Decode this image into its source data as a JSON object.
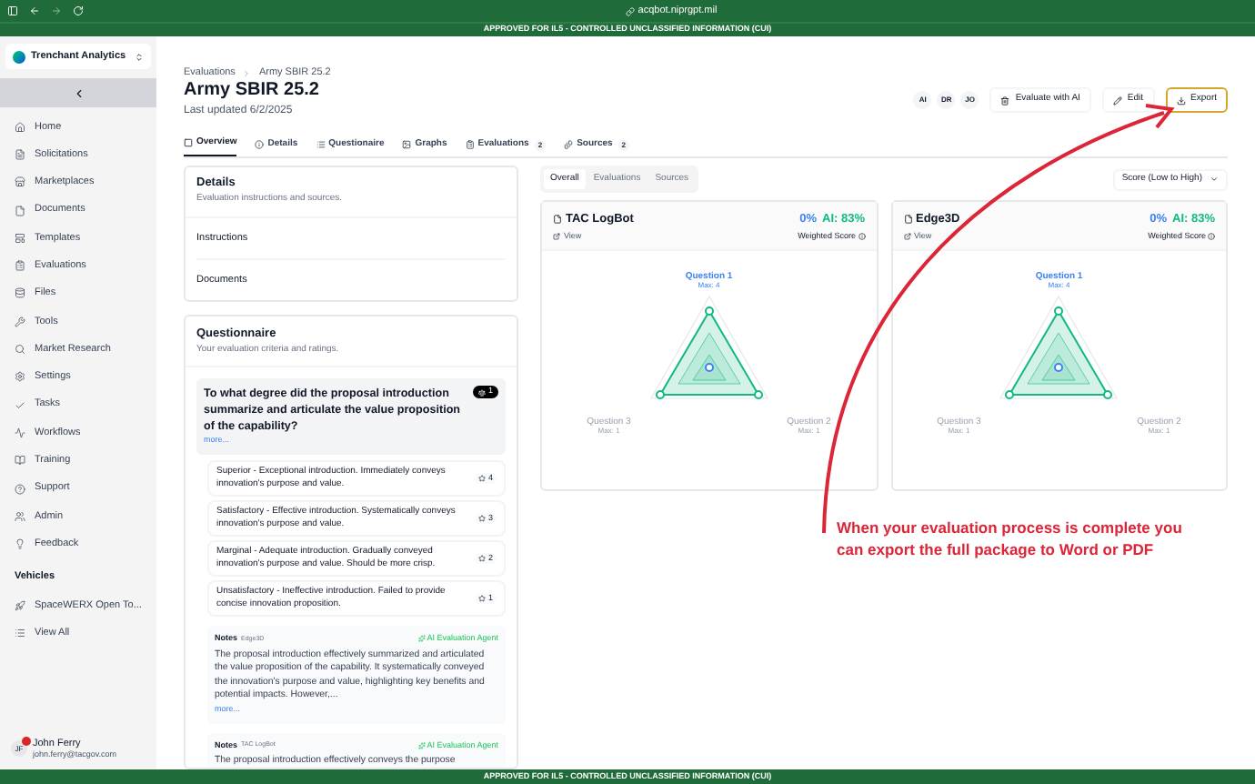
{
  "browser": {
    "url": "acqbot.niprgpt.mil"
  },
  "banner": {
    "top": "APPROVED FOR IL5 - CONTROLLED UNCLASSIFIED INFORMATION (CUI)",
    "bottom": "APPROVED FOR IL5 - CONTROLLED UNCLASSIFIED INFORMATION (CUI)"
  },
  "sidebar": {
    "org": "Trenchant Analytics",
    "items": [
      {
        "label": "Home"
      },
      {
        "label": "Solicitations"
      },
      {
        "label": "Marketplaces"
      },
      {
        "label": "Documents"
      },
      {
        "label": "Templates"
      },
      {
        "label": "Evaluations"
      },
      {
        "label": "Files"
      },
      {
        "label": "Tools"
      },
      {
        "label": "Market Research"
      },
      {
        "label": "Settings"
      },
      {
        "label": "Tasks"
      },
      {
        "label": "Workflows"
      },
      {
        "label": "Training"
      },
      {
        "label": "Support"
      },
      {
        "label": "Admin"
      },
      {
        "label": "Feedback"
      }
    ],
    "section": "Vehicles",
    "vehicles": [
      {
        "label": "SpaceWERX Open To..."
      },
      {
        "label": "View All"
      }
    ],
    "user": {
      "initials": "JF",
      "name": "John Ferry",
      "email": "john.ferry@tacgov.com"
    }
  },
  "header": {
    "breadcrumb": [
      "Evaluations",
      "Army SBIR 25.2"
    ],
    "title": "Army SBIR 25.2",
    "updated": "Last updated 6/2/2025",
    "avatars": [
      "AI",
      "DR",
      "JO"
    ],
    "buttons": [
      {
        "label": "Evaluate with AI",
        "highlighted": false
      },
      {
        "label": "Edit",
        "highlighted": false
      },
      {
        "label": "Export",
        "highlighted": true
      }
    ]
  },
  "tabs": [
    {
      "label": "Overview",
      "selected": true
    },
    {
      "label": "Details",
      "selected": false
    },
    {
      "label": "Questionaire",
      "selected": false
    },
    {
      "label": "Graphs",
      "selected": false
    },
    {
      "label": "Evaluations",
      "count": "2",
      "selected": false
    },
    {
      "label": "Sources",
      "count": "2",
      "selected": false
    }
  ],
  "details": {
    "title": "Details",
    "subtitle": "Evaluation instructions and sources.",
    "rows": [
      "Instructions",
      "Documents"
    ]
  },
  "questionnaire": {
    "title": "Questionnaire",
    "subtitle": "Your evaluation criteria and ratings.",
    "question": {
      "text": "To what degree did the proposal introduction summarize and articulate the value proposition of the capability?",
      "more": "more...",
      "weight": "1"
    },
    "options": [
      {
        "text": "Superior - Exceptional introduction. Immediately conveys innovation's purpose and value.",
        "score": "4"
      },
      {
        "text": "Satisfactory - Effective introduction. Systematically conveys innovation's purpose and value.",
        "score": "3"
      },
      {
        "text": "Marginal - Adequate introduction. Gradually conveyed innovation's purpose and value. Should be more crisp.",
        "score": "2"
      },
      {
        "text": "Unsatisfactory - Ineffective introduction. Failed to provide concise innovation proposition.",
        "score": "1"
      }
    ],
    "notes": [
      {
        "label": "Notes",
        "source": "Edge3D",
        "agent": "AI Evaluation Agent",
        "text": "The proposal introduction effectively summarized and articulated the value proposition of the capability. It systematically conveyed the innovation's purpose and value, highlighting key benefits and potential impacts. However,...",
        "more": "more..."
      },
      {
        "label": "Notes",
        "source": "TAC LogBot",
        "agent": "AI Evaluation Agent",
        "text": "The proposal introduction effectively conveys the purpose"
      }
    ]
  },
  "view_tabs": [
    {
      "label": "Overall",
      "selected": true
    },
    {
      "label": "Evaluations",
      "selected": false
    },
    {
      "label": "Sources",
      "selected": false
    }
  ],
  "sort": {
    "value": "Score (Low to High)"
  },
  "cards": [
    {
      "name": "TAC LogBot",
      "view": "View",
      "score": "0%",
      "ai": "AI: 83%",
      "score_label": "Weighted Score",
      "axes": [
        {
          "label": "Question 1",
          "max": "Max: 4"
        },
        {
          "label": "Question 3",
          "max": "Max: 1"
        },
        {
          "label": "Question 2",
          "max": "Max: 1"
        }
      ]
    },
    {
      "name": "Edge3D",
      "view": "View",
      "score": "0%",
      "ai": "AI: 83%",
      "score_label": "Weighted Score",
      "axes": [
        {
          "label": "Question 1",
          "max": "Max: 4"
        },
        {
          "label": "Question 3",
          "max": "Max: 1"
        },
        {
          "label": "Question 2",
          "max": "Max: 1"
        }
      ]
    }
  ],
  "annotation": {
    "text": "When your evaluation process is complete you can export the full package to Word or PDF"
  }
}
